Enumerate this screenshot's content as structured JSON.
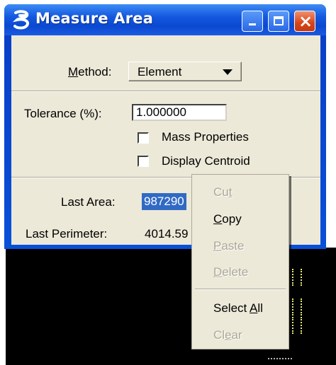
{
  "window": {
    "title": "Measure Area",
    "icon": "microstation-b-icon"
  },
  "titlebar_buttons": {
    "minimize": "minimize-icon",
    "maximize": "maximize-icon",
    "close": "×"
  },
  "method": {
    "label_prefix": "M",
    "label_rest": "ethod:",
    "selected": "Element"
  },
  "tolerance": {
    "label": "Tolerance (%):",
    "value": "1.000000"
  },
  "options": {
    "mass_properties": "Mass Properties",
    "display_centroid": "Display Centroid"
  },
  "results": {
    "last_area_label": "Last Area:",
    "last_area_value": "987290",
    "last_perimeter_label": "Last Perimeter:",
    "last_perimeter_value": "4014.59"
  },
  "context_menu": {
    "cut": {
      "pre": "Cu",
      "key": "t",
      "post": ""
    },
    "copy": {
      "pre": "",
      "key": "C",
      "post": "opy"
    },
    "paste": {
      "pre": "",
      "key": "P",
      "post": "aste"
    },
    "delete": {
      "pre": "",
      "key": "D",
      "post": "elete"
    },
    "select_all": {
      "pre": "Select ",
      "key": "A",
      "post": "ll"
    },
    "clear": {
      "pre": "Cl",
      "key": "e",
      "post": "ar"
    }
  },
  "colors": {
    "titlebar": "#0b49d0",
    "dialog_bg": "#ece9d8",
    "selection": "#316ac5",
    "close_button": "#d84418"
  }
}
